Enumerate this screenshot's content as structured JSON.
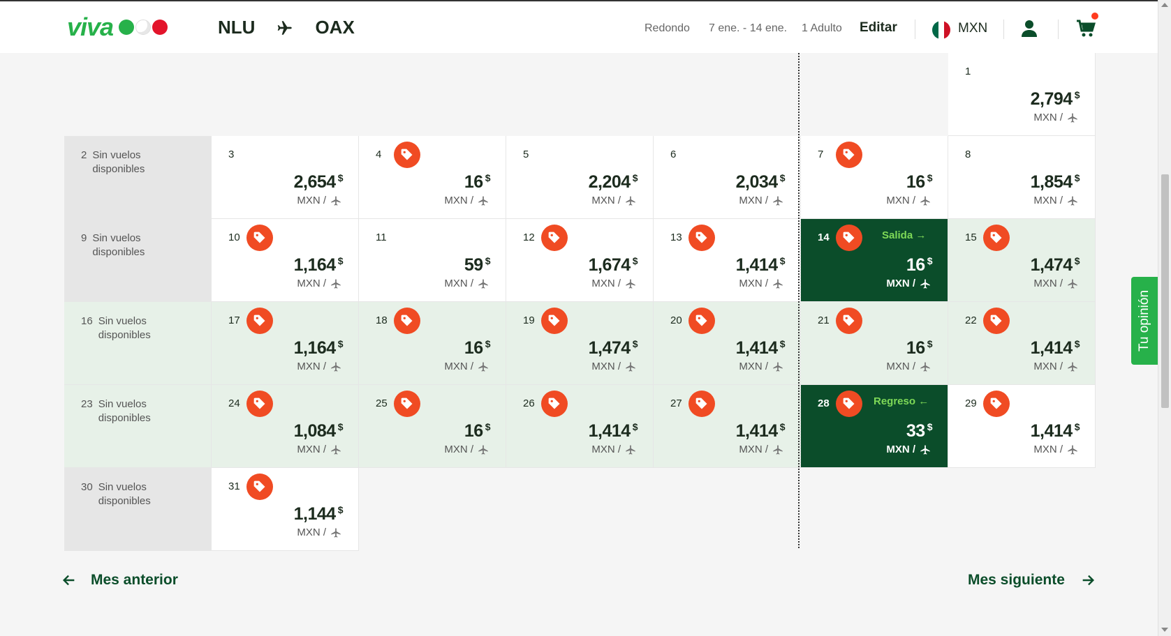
{
  "header": {
    "brand": "viva",
    "origin": "NLU",
    "destination": "OAX",
    "trip_type": "Redondo",
    "dates": "7 ene. - 14 ene.",
    "passengers": "1 Adulto",
    "edit_label": "Editar",
    "currency": "MXN"
  },
  "calendar": {
    "currency_symbol": "$",
    "unit_label": "MXN /",
    "no_flights_label": "Sin vuelos\ndisponibles",
    "departure_label": "Salida",
    "return_label": "Regreso",
    "colors": {
      "brand_green": "#27b14a",
      "selected_dark": "#0b4d2a",
      "in_range": "#e7f1e8",
      "tag_orange": "#f04b23"
    },
    "days": [
      {
        "day": "1",
        "row": 0,
        "col": 6,
        "price": "2,794",
        "deal": false,
        "style": "white"
      },
      {
        "day": "2",
        "row": 1,
        "col": 0,
        "no_flights": true,
        "style": "gray"
      },
      {
        "day": "3",
        "row": 1,
        "col": 1,
        "price": "2,654",
        "deal": false,
        "style": "white"
      },
      {
        "day": "4",
        "row": 1,
        "col": 2,
        "price": "16",
        "deal": true,
        "style": "white"
      },
      {
        "day": "5",
        "row": 1,
        "col": 3,
        "price": "2,204",
        "deal": false,
        "style": "white"
      },
      {
        "day": "6",
        "row": 1,
        "col": 4,
        "price": "2,034",
        "deal": false,
        "style": "white"
      },
      {
        "day": "7",
        "row": 1,
        "col": 5,
        "price": "16",
        "deal": true,
        "style": "white"
      },
      {
        "day": "8",
        "row": 1,
        "col": 6,
        "price": "1,854",
        "deal": false,
        "style": "white"
      },
      {
        "day": "9",
        "row": 2,
        "col": 0,
        "no_flights": true,
        "style": "gray"
      },
      {
        "day": "10",
        "row": 2,
        "col": 1,
        "price": "1,164",
        "deal": true,
        "style": "white"
      },
      {
        "day": "11",
        "row": 2,
        "col": 2,
        "price": "59",
        "deal": false,
        "style": "white"
      },
      {
        "day": "12",
        "row": 2,
        "col": 3,
        "price": "1,674",
        "deal": true,
        "style": "white"
      },
      {
        "day": "13",
        "row": 2,
        "col": 4,
        "price": "1,414",
        "deal": true,
        "style": "white"
      },
      {
        "day": "14",
        "row": 2,
        "col": 5,
        "price": "16",
        "deal": true,
        "style": "dark",
        "badge": "departure"
      },
      {
        "day": "15",
        "row": 2,
        "col": 6,
        "price": "1,474",
        "deal": true,
        "style": "light"
      },
      {
        "day": "16",
        "row": 3,
        "col": 0,
        "no_flights": true,
        "style": "light"
      },
      {
        "day": "17",
        "row": 3,
        "col": 1,
        "price": "1,164",
        "deal": true,
        "style": "light"
      },
      {
        "day": "18",
        "row": 3,
        "col": 2,
        "price": "16",
        "deal": true,
        "style": "light"
      },
      {
        "day": "19",
        "row": 3,
        "col": 3,
        "price": "1,474",
        "deal": true,
        "style": "light"
      },
      {
        "day": "20",
        "row": 3,
        "col": 4,
        "price": "1,414",
        "deal": true,
        "style": "light"
      },
      {
        "day": "21",
        "row": 3,
        "col": 5,
        "price": "16",
        "deal": true,
        "style": "light"
      },
      {
        "day": "22",
        "row": 3,
        "col": 6,
        "price": "1,414",
        "deal": true,
        "style": "light"
      },
      {
        "day": "23",
        "row": 4,
        "col": 0,
        "no_flights": true,
        "style": "light"
      },
      {
        "day": "24",
        "row": 4,
        "col": 1,
        "price": "1,084",
        "deal": true,
        "style": "light"
      },
      {
        "day": "25",
        "row": 4,
        "col": 2,
        "price": "16",
        "deal": true,
        "style": "light"
      },
      {
        "day": "26",
        "row": 4,
        "col": 3,
        "price": "1,414",
        "deal": true,
        "style": "light"
      },
      {
        "day": "27",
        "row": 4,
        "col": 4,
        "price": "1,414",
        "deal": true,
        "style": "light"
      },
      {
        "day": "28",
        "row": 4,
        "col": 5,
        "price": "33",
        "deal": true,
        "style": "dark",
        "badge": "return"
      },
      {
        "day": "29",
        "row": 4,
        "col": 6,
        "price": "1,414",
        "deal": true,
        "style": "white"
      },
      {
        "day": "30",
        "row": 5,
        "col": 0,
        "no_flights": true,
        "style": "gray"
      },
      {
        "day": "31",
        "row": 5,
        "col": 1,
        "price": "1,144",
        "deal": true,
        "style": "white"
      }
    ]
  },
  "nav": {
    "prev_label": "Mes anterior",
    "next_label": "Mes siguiente"
  },
  "feedback_label": "Tu opinión"
}
